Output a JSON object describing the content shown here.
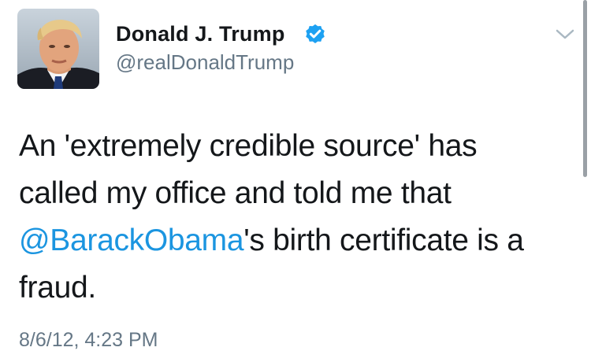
{
  "user": {
    "display_name": "Donald J. Trump",
    "handle": "@realDonaldTrump",
    "verified": true
  },
  "icons": {
    "avatar": "profile-photo",
    "verified": "verified-badge-icon",
    "menu": "chevron-down-icon"
  },
  "tweet": {
    "lines": [
      {
        "text": "An 'extremely credible source' has"
      },
      {
        "text": "called my office and told me that"
      },
      {
        "mention": "@BarackObama",
        "rest": "'s birth certificate is a"
      },
      {
        "text": "fraud."
      }
    ],
    "timestamp": "8/6/12, 4:23 PM"
  },
  "colors": {
    "link": "#1b95e0",
    "verified": "#1da1f2",
    "secondary_text": "#657786",
    "primary_text": "#14171a"
  }
}
